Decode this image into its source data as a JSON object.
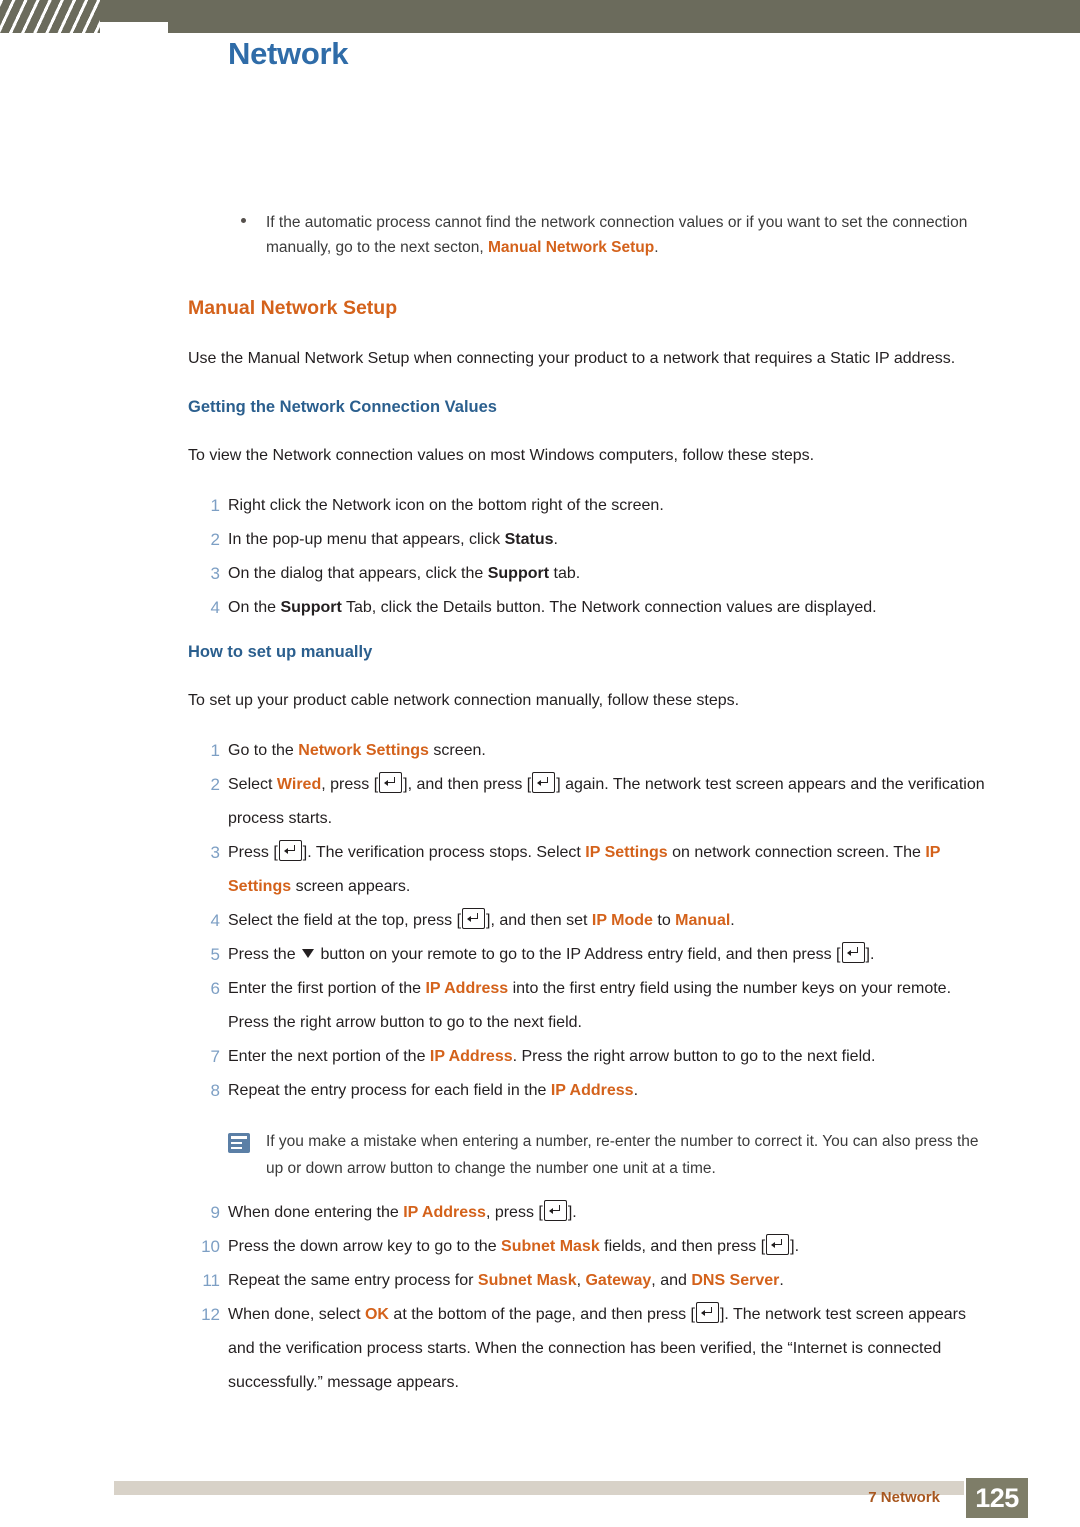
{
  "header": {
    "title": "Network"
  },
  "footer": {
    "chapter": "7 Network",
    "page": "125"
  },
  "top_note": {
    "text_1": "If the automatic process cannot find the network connection values or if you want to set the connection manually, go to the next secton, ",
    "link": "Manual Network Setup",
    "text_2": "."
  },
  "section": {
    "heading": "Manual Network Setup",
    "intro": "Use the Manual Network Setup when connecting your product to a network that requires a Static IP address.",
    "sub1_heading": "Getting the Network Connection Values",
    "sub1_intro": "To view the Network connection values on most Windows computers, follow these steps.",
    "sub2_heading": "How to set up manually",
    "sub2_intro": "To set up your product cable network connection manually, follow these steps."
  },
  "list1": [
    {
      "num": "1",
      "t1": "Right click the Network icon on the bottom right of the screen."
    },
    {
      "num": "2",
      "t1": "In the pop-up menu that appears, click ",
      "b1": "Status",
      "t2": "."
    },
    {
      "num": "3",
      "t1": "On the dialog that appears, click the ",
      "b1": "Support",
      "t2": " tab."
    },
    {
      "num": "4",
      "t1": "On the ",
      "b1": "Support",
      "t2": " Tab, click the Details button. The Network connection values are displayed."
    }
  ],
  "list2": {
    "i1": {
      "num": "1",
      "a": "Go to the ",
      "o1": "Network Settings",
      "b": " screen."
    },
    "i2": {
      "num": "2",
      "a": "Select ",
      "o1": "Wired",
      "b": ", press [",
      "c": "], and then press [",
      "d": "] again. The network test screen appears and the verification process starts."
    },
    "i3": {
      "num": "3",
      "a": "Press [",
      "b": "]. The verification process stops. Select ",
      "o1": "IP Settings",
      "c": " on network connection screen. The ",
      "o2": "IP Settings",
      "d": " screen appears."
    },
    "i4": {
      "num": "4",
      "a": "Select the field at the top, press [",
      "b": "], and then set ",
      "o1": "IP Mode",
      "c": " to ",
      "o2": "Manual",
      "d": "."
    },
    "i5": {
      "num": "5",
      "a": "Press the ",
      "b": " button on your remote to go to the IP Address entry field, and then press [",
      "c": "]."
    },
    "i6": {
      "num": "6",
      "a": "Enter the first portion of the ",
      "o1": "IP Address",
      "b": " into the first entry field using the number keys on your remote. Press the right arrow button to go to the next field."
    },
    "i7": {
      "num": "7",
      "a": "Enter the next portion of the ",
      "o1": "IP Address",
      "b": ". Press the right arrow button to go to the next field."
    },
    "i8": {
      "num": "8",
      "a": "Repeat the entry process for each field in the ",
      "o1": "IP Address",
      "b": "."
    },
    "note": "If you make a mistake when entering a number, re-enter the number to correct it. You can also press the up or down arrow button to change the number one unit at a time.",
    "i9": {
      "num": "9",
      "a": "When done entering the ",
      "o1": "IP Address",
      "b": ", press [",
      "c": "]."
    },
    "i10": {
      "num": "10",
      "a": "Press the down arrow key to go to the ",
      "o1": "Subnet Mask",
      "b": " fields, and then press [",
      "c": "]."
    },
    "i11": {
      "num": "11",
      "a": "Repeat the same entry process for ",
      "o1": "Subnet Mask",
      "b": ", ",
      "o2": "Gateway",
      "c": ", and ",
      "o3": "DNS Server",
      "d": "."
    },
    "i12": {
      "num": "12",
      "a": "When done, select ",
      "o1": "OK",
      "b": " at the bottom of the page, and then press [",
      "c": "]. The network test screen appears and the verification process starts. When the connection has been verified, the “Internet is connected successfully.” message appears."
    }
  },
  "colors": {
    "header_bar": "#6b6b5c",
    "title_blue": "#2f6ca8",
    "accent_orange": "#d4621b",
    "sub_blue": "#2b5f8e",
    "number_blue": "#7d9fc4",
    "footer_box": "#7e7d68"
  }
}
